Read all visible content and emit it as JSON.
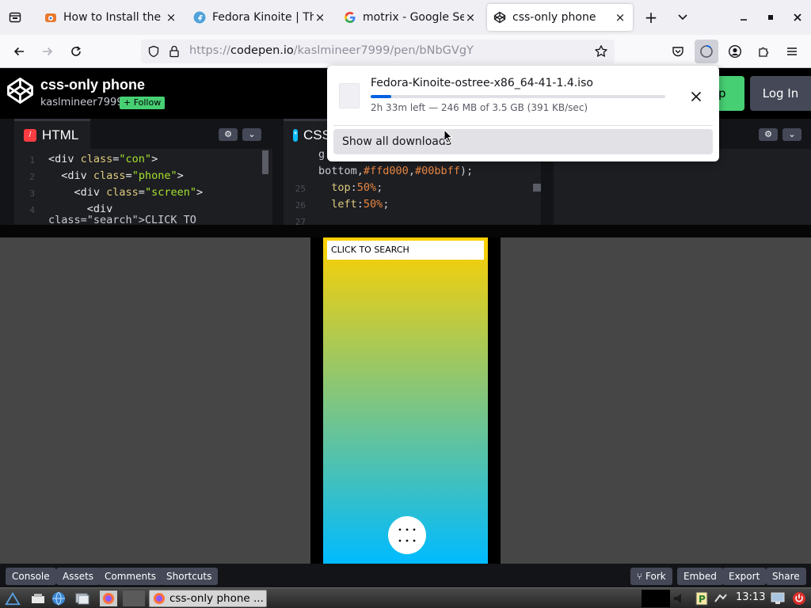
{
  "browser": {
    "tabs": [
      {
        "title": "How to Install the Latest",
        "favicon": "fdroid-icon"
      },
      {
        "title": "Fedora Kinoite | The Fedo",
        "favicon": "fedora-icon"
      },
      {
        "title": "motrix - Google Search",
        "favicon": "google-icon"
      },
      {
        "title": "css-only phone",
        "favicon": "codepen-icon",
        "active": true
      }
    ],
    "url": {
      "prefix": "https://",
      "host": "codepen.io",
      "path": "/kaslmineer7999/pen/bNbGVgY"
    }
  },
  "codepen": {
    "pen_title": "css-only phone",
    "username": "kaslmineer7999",
    "follow_label": "+ Follow",
    "signup_label": "Up",
    "login_label": "Log In",
    "html_editor": {
      "label": "HTML",
      "line_numbers": "1\n2\n3\n4",
      "lines": [
        {
          "indent": "",
          "tag_open": "<div ",
          "attr": "class",
          "eq": "=",
          "value": "\"con\"",
          "tag_close": ">"
        },
        {
          "indent": "  ",
          "tag_open": "<div ",
          "attr": "class",
          "eq": "=",
          "value": "\"phone\"",
          "tag_close": ">"
        },
        {
          "indent": "    ",
          "tag_open": "<div ",
          "attr": "class",
          "eq": "=",
          "value": "\"screen\"",
          "tag_close": ">"
        },
        {
          "indent": "      ",
          "tag_open": "<div",
          "attr": "",
          "eq": "",
          "value": "",
          "tag_close": ""
        }
      ],
      "partial_line": "class=\"search\">CLICK TO"
    },
    "css_editor": {
      "label": "CSS",
      "line_numbers": "\n\n25\n26\n27",
      "line1": "g",
      "line2_prefix": "bottom,",
      "line2_hex1": "#ffd000",
      "line2_comma": ",",
      "line2_hex2": "#00bbff",
      "line2_suffix": ");",
      "line3_prop": "top",
      "line3_val": "50%",
      "line4_prop": "left",
      "line4_val": "50%"
    },
    "preview": {
      "search_text": "CLICK TO SEARCH",
      "menu_dots": "⋮⋮",
      "gradient_start": "#ffd000",
      "gradient_end": "#00bbff"
    },
    "footer": {
      "console": "Console",
      "assets": "Assets",
      "comments": "Comments",
      "shortcuts": "Shortcuts",
      "fork": "Fork",
      "embed": "Embed",
      "export": "Export",
      "share": "Share"
    }
  },
  "downloads": {
    "file_name": "Fedora-Kinoite-ostree-x86_64-41-1.4.iso",
    "status": "2h 33m left — 246 MB of 3.5 GB (391 KB/sec)",
    "progress": 0.07,
    "show_all": "Show all downloads",
    "accent": "#0061e0"
  },
  "taskbar": {
    "window_title": "css-only phone ...",
    "clock": "13:13"
  }
}
